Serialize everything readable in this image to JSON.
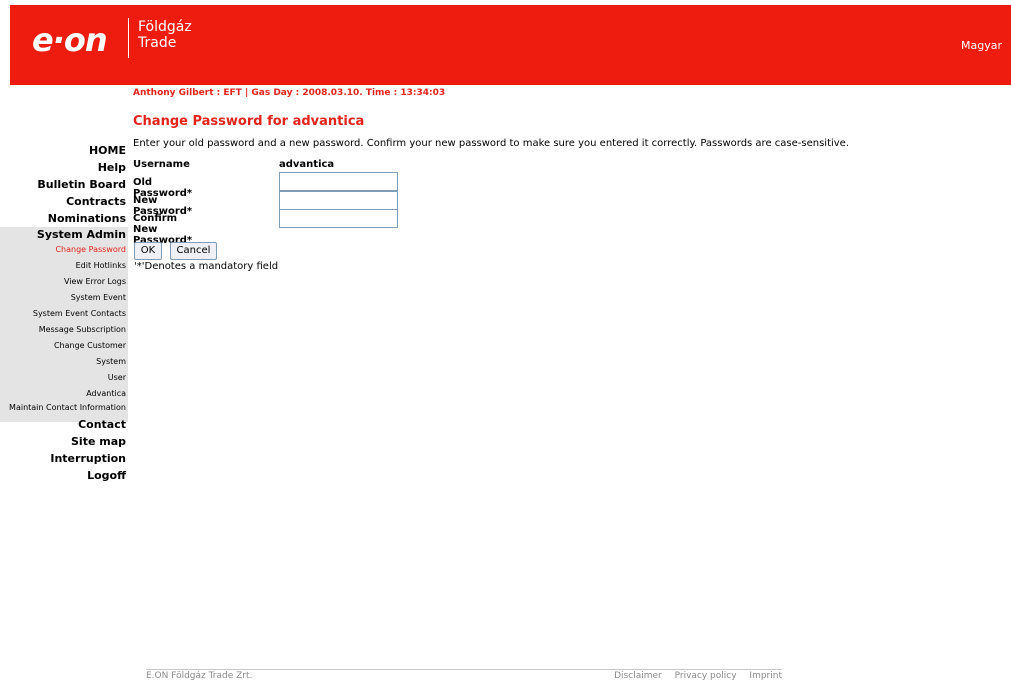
{
  "header": {
    "logo": "e·on",
    "brand_line1": "Földgáz",
    "brand_line2": "Trade",
    "language": "Magyar",
    "colors": {
      "header_bg": "#ee1c0e",
      "accent_text": "#e2231a"
    }
  },
  "status_line": "Anthony Gilbert : EFT | Gas Day : 2008.03.10. Time : 13:34:03",
  "page": {
    "title": "Change Password for advantica",
    "intro": "Enter your old password and a new password. Confirm your new password to make sure you entered it correctly. Passwords are case-sensitive."
  },
  "nav": {
    "home": "HOME",
    "help": "Help",
    "bulletin": "Bulletin Board",
    "contracts": "Contracts",
    "nominations": "Nominations",
    "system_admin": "System Admin",
    "admin_items": [
      "Change Password",
      "Edit Hotlinks",
      "View Error Logs",
      "System Event",
      "System Event Contacts",
      "Message Subscription",
      "Change Customer",
      "System",
      "User",
      "Advantica",
      "Maintain Contact Information"
    ],
    "contact": "Contact",
    "sitemap": "Site map",
    "interruption": "Interruption",
    "logoff": "Logoff"
  },
  "form": {
    "username_label": "Username",
    "username_value": "advantica",
    "old_label": "Old Password*",
    "old_value": "",
    "new_label": "New Password*",
    "new_value": "",
    "confirm_label": "Confirm New Password*",
    "confirm_value": "",
    "ok_label": "OK",
    "cancel_label": "Cancel",
    "mandatory_note": "'*'Denotes a mandatory field"
  },
  "footer": {
    "company": "E.ON Földgáz Trade Zrt.",
    "disclaimer": "Disclaimer",
    "privacy": "Privacy policy",
    "imprint": "Imprint"
  }
}
